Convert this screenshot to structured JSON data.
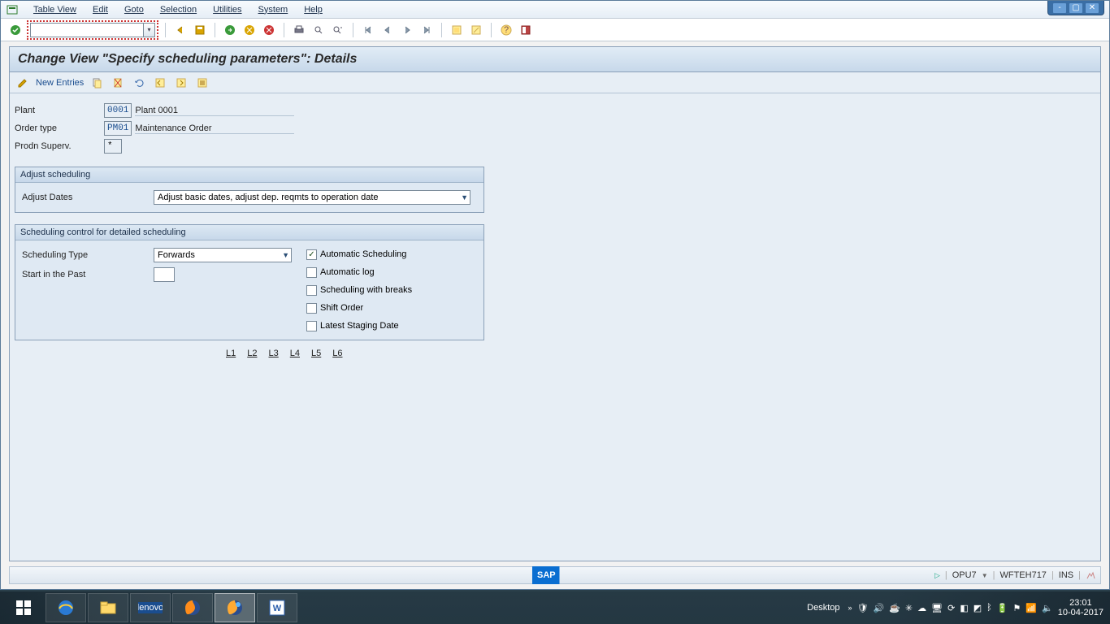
{
  "menu": {
    "items": [
      "Table View",
      "Edit",
      "Goto",
      "Selection",
      "Utilities",
      "System",
      "Help"
    ]
  },
  "page": {
    "title": "Change View \"Specify scheduling parameters\": Details",
    "new_entries": "New Entries"
  },
  "header": {
    "plant_label": "Plant",
    "plant": "0001",
    "plant_desc": "Plant 0001",
    "order_type_label": "Order type",
    "order_type": "PM01",
    "order_type_desc": "Maintenance Order",
    "prodn_label": "Prodn Superv.",
    "prodn": "*"
  },
  "group1": {
    "title": "Adjust scheduling",
    "adjust_dates_label": "Adjust Dates",
    "adjust_dates_value": "Adjust basic dates, adjust dep. reqmts to operation date"
  },
  "group2": {
    "title": "Scheduling control for detailed scheduling",
    "sched_type_label": "Scheduling Type",
    "sched_type_value": "Forwards",
    "start_past_label": "Start in the Past",
    "start_past_value": "",
    "checks": {
      "auto_sched": "Automatic Scheduling",
      "auto_log": "Automatic log",
      "with_breaks": "Scheduling with breaks",
      "shift_order": "Shift Order",
      "latest_staging": "Latest Staging Date"
    }
  },
  "levels": [
    "L1",
    "L2",
    "L3",
    "L4",
    "L5",
    "L6"
  ],
  "status": {
    "sap": "SAP",
    "sys": "OPU7",
    "host": "WFTEH717",
    "mode": "INS"
  },
  "taskbar": {
    "desktop": "Desktop",
    "time": "23:01",
    "date": "10-04-2017"
  }
}
